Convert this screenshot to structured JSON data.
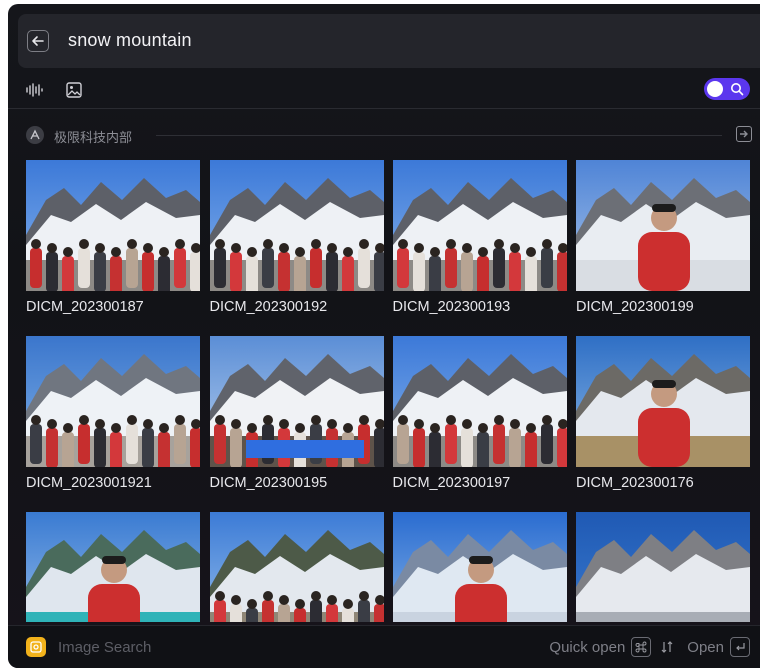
{
  "search": {
    "query": "snow mountain"
  },
  "toolbar": {
    "icons": [
      "voice-wave-icon",
      "image-icon"
    ],
    "toggle_on": true,
    "accent": "#5b37ee"
  },
  "section": {
    "title": "极限科技内部"
  },
  "results": [
    {
      "caption": "DICM_202300187",
      "scene": "crowd"
    },
    {
      "caption": "DICM_202300192",
      "scene": "crowd"
    },
    {
      "caption": "DICM_202300193",
      "scene": "crowd"
    },
    {
      "caption": "DICM_202300199",
      "scene": "portrait"
    },
    {
      "caption": "DICM_2023001921",
      "scene": "overlook"
    },
    {
      "caption": "DICM_202300195",
      "scene": "group"
    },
    {
      "caption": "DICM_202300197",
      "scene": "crowd"
    },
    {
      "caption": "DICM_202300176",
      "scene": "plateau"
    },
    {
      "caption": "",
      "scene": "lake"
    },
    {
      "caption": "",
      "scene": "valley"
    },
    {
      "caption": "",
      "scene": "summit"
    },
    {
      "caption": "",
      "scene": "blue"
    }
  ],
  "footer": {
    "label": "Image Search",
    "quick_open": "Quick open",
    "open": "Open",
    "accent": "#f2b21b"
  }
}
